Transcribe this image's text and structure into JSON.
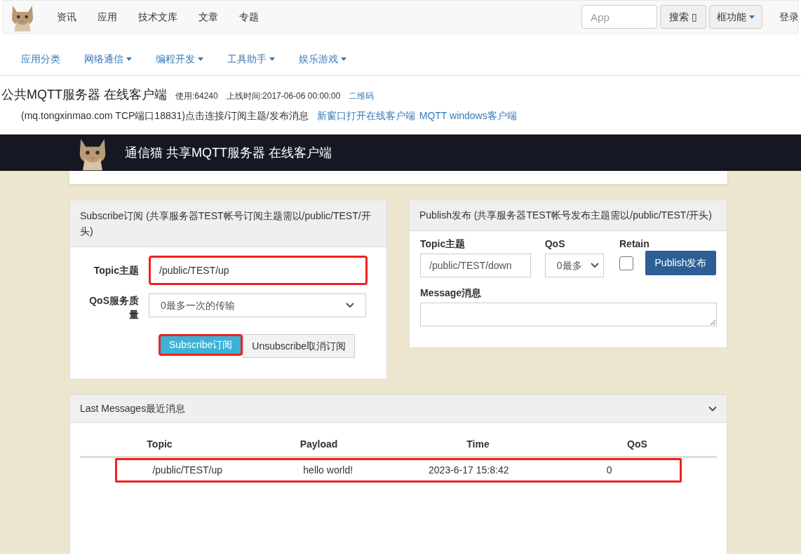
{
  "top_nav": {
    "items": [
      "资讯",
      "应用",
      "技术文库",
      "文章",
      "专题"
    ],
    "search": {
      "placeholder": "App"
    },
    "search_button": "搜索 ▯",
    "menu_button": "框功能",
    "login": "登录"
  },
  "sub_nav": [
    {
      "label": "应用分类",
      "dropdown": false
    },
    {
      "label": "网络通信",
      "dropdown": true
    },
    {
      "label": "编程开发",
      "dropdown": true
    },
    {
      "label": "工具助手",
      "dropdown": true
    },
    {
      "label": "娱乐游戏",
      "dropdown": true
    }
  ],
  "header": {
    "title": "公共MQTT服务器 在线客户端",
    "usage": "使用:64240",
    "online_time": "上线时间:2017-06-06 00:00:00",
    "qr_link": "二维码",
    "description": "(mq.tongxinmao.com TCP端口18831)点击连接/订阅主题/发布消息",
    "links": [
      "新窗口打开在线客户端",
      "MQTT windows客户端"
    ]
  },
  "banner": {
    "title": "通信猫 共享MQTT服务器 在线客户端"
  },
  "subscribe": {
    "title": "Subscribe订阅 (共享服务器TEST帐号订阅主题需以/public/TEST/开头)",
    "topic_label": "Topic主题",
    "topic_value": "/public/TEST/up",
    "qos_label": "QoS服务质量",
    "qos_value": "0最多一次的传输",
    "subscribe_button": "Subscribe订阅",
    "unsubscribe_button": "Unsubscribe取消订阅"
  },
  "publish": {
    "title": "Publish发布 (共享服务器TEST帐号发布主题需以/public/TEST/开头)",
    "topic_label": "Topic主题",
    "topic_value": "/public/TEST/down",
    "qos_label": "QoS",
    "qos_value": "0最多",
    "retain_label": "Retain",
    "retain_checked": false,
    "publish_button": "Publish发布",
    "message_label": "Message消息"
  },
  "messages": {
    "title": "Last Messages最近消息",
    "columns": [
      "Topic",
      "Payload",
      "Time",
      "QoS"
    ],
    "rows": [
      [
        "/public/TEST/up",
        "hello world!",
        "2023-6-17 15:8:42",
        "0"
      ]
    ]
  }
}
